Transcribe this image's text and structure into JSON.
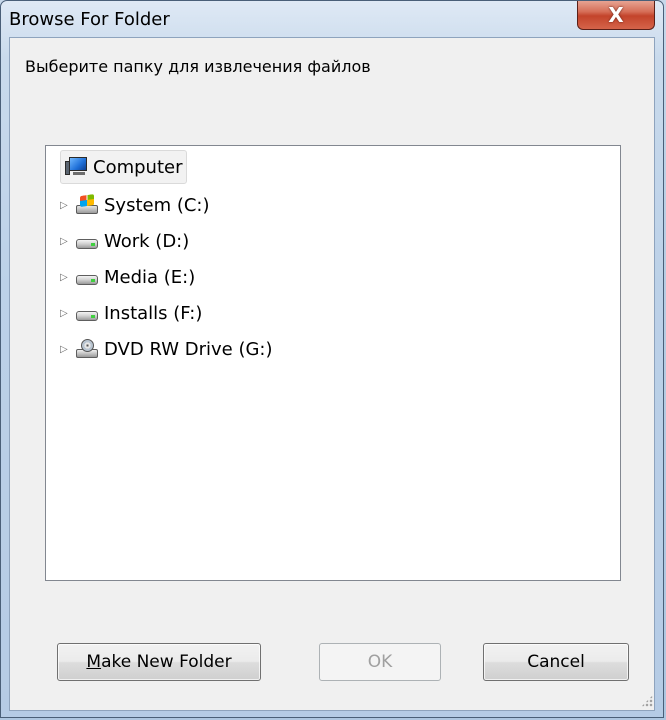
{
  "window": {
    "title": "Browse For Folder",
    "close_label": "X"
  },
  "dialog": {
    "instruction": "Выберите папку для извлечения файлов"
  },
  "tree": {
    "root": {
      "label": "Computer",
      "icon": "computer-icon"
    },
    "items": [
      {
        "label": "System (C:)",
        "icon": "system-drive-icon"
      },
      {
        "label": "Work (D:)",
        "icon": "hard-drive-icon"
      },
      {
        "label": "Media (E:)",
        "icon": "hard-drive-icon"
      },
      {
        "label": "Installs (F:)",
        "icon": "hard-drive-icon"
      },
      {
        "label": "DVD RW Drive (G:)",
        "icon": "dvd-drive-icon"
      }
    ],
    "expander_glyph": "▷"
  },
  "buttons": {
    "make_new_folder_accel": "M",
    "make_new_folder_rest": "ake New Folder",
    "ok": "OK",
    "cancel": "Cancel"
  },
  "colors": {
    "close_button": "#c3442b",
    "frame": "#bcd1e8"
  }
}
